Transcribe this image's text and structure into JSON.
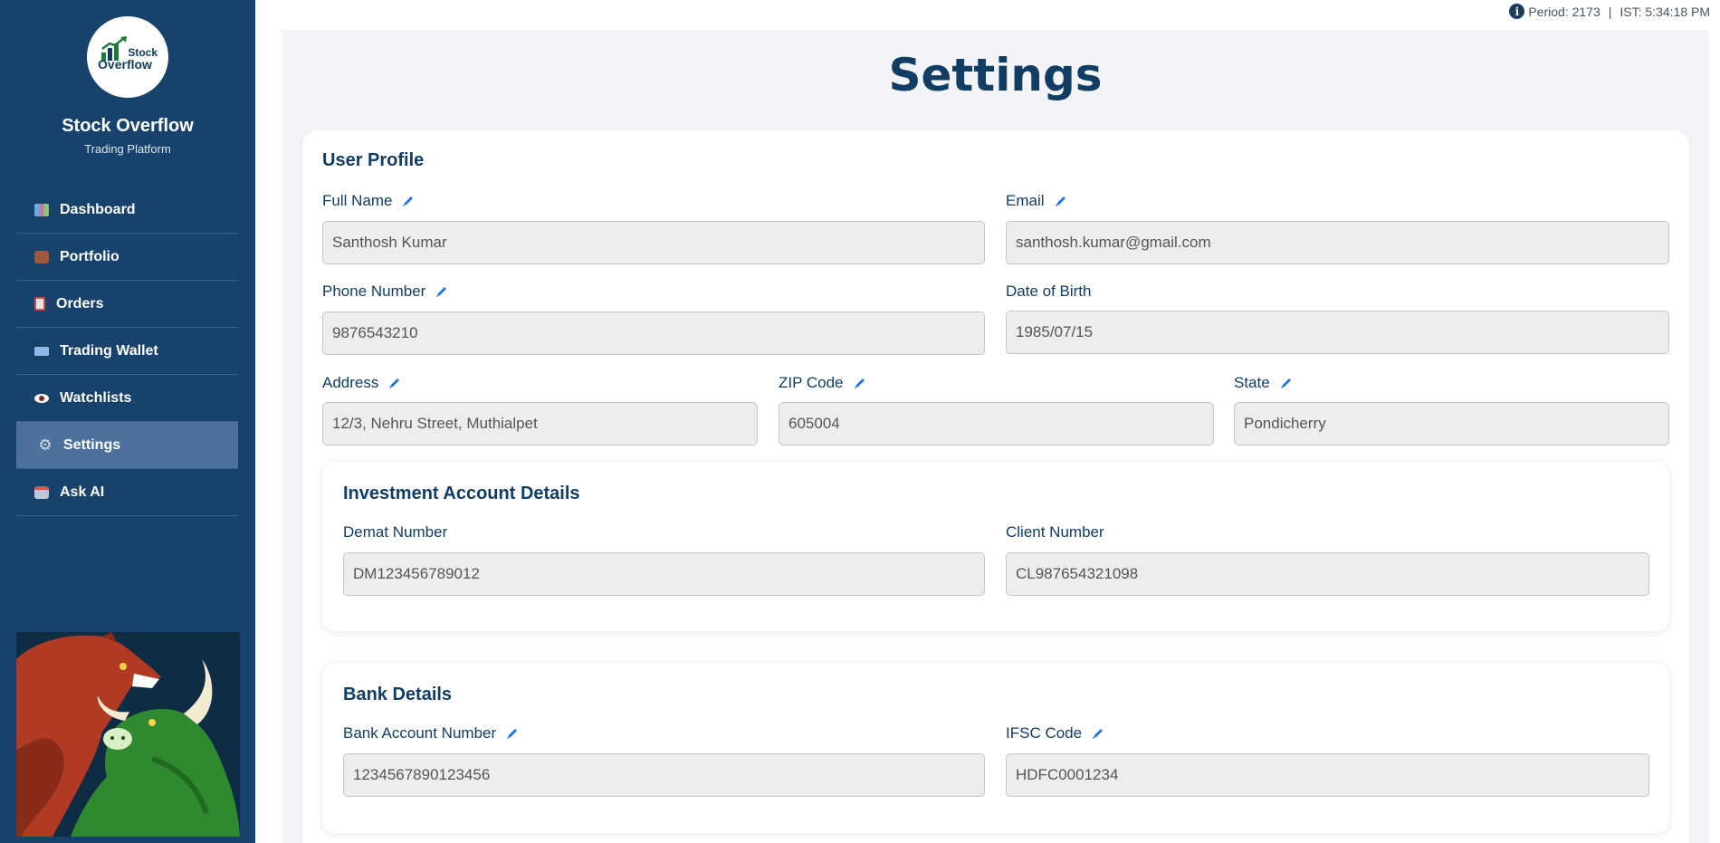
{
  "top_status": {
    "period": "Period: 2173",
    "separator": "|",
    "ist": "IST: 5:34:18 PM"
  },
  "sidebar": {
    "logo_line1": "Stock",
    "logo_line2": "Overflow",
    "brand_name": "Stock Overflow",
    "brand_sub": "Trading Platform",
    "items": [
      {
        "label": "Dashboard",
        "icon": "chart-icon"
      },
      {
        "label": "Portfolio",
        "icon": "briefcase-icon"
      },
      {
        "label": "Orders",
        "icon": "clipboard-icon"
      },
      {
        "label": "Trading Wallet",
        "icon": "card-icon"
      },
      {
        "label": "Watchlists",
        "icon": "eye-icon"
      },
      {
        "label": "Settings",
        "icon": "gear-icon",
        "active": true
      },
      {
        "label": "Ask AI",
        "icon": "robot-icon"
      }
    ]
  },
  "page": {
    "title": "Settings"
  },
  "profile": {
    "title": "User Profile",
    "full_name": {
      "label": "Full Name",
      "value": "Santhosh Kumar"
    },
    "email": {
      "label": "Email",
      "value": "santhosh.kumar@gmail.com"
    },
    "phone": {
      "label": "Phone Number",
      "value": "9876543210"
    },
    "dob": {
      "label": "Date of Birth",
      "value": "1985/07/15"
    },
    "address": {
      "label": "Address",
      "value": "12/3, Nehru Street, Muthialpet"
    },
    "zip": {
      "label": "ZIP Code",
      "value": "605004"
    },
    "state": {
      "label": "State",
      "value": "Pondicherry"
    }
  },
  "investment": {
    "title": "Investment Account Details",
    "demat": {
      "label": "Demat Number",
      "value": "DM123456789012"
    },
    "client": {
      "label": "Client Number",
      "value": "CL987654321098"
    }
  },
  "bank": {
    "title": "Bank Details",
    "account": {
      "label": "Bank Account Number",
      "value": "1234567890123456"
    },
    "ifsc": {
      "label": "IFSC Code",
      "value": "HDFC0001234"
    }
  },
  "colors": {
    "sidebar": "#17426b",
    "active_item": "#4c719a",
    "heading": "#123d63",
    "input_bg": "#ededed",
    "edit_icon": "#1a73e8"
  }
}
